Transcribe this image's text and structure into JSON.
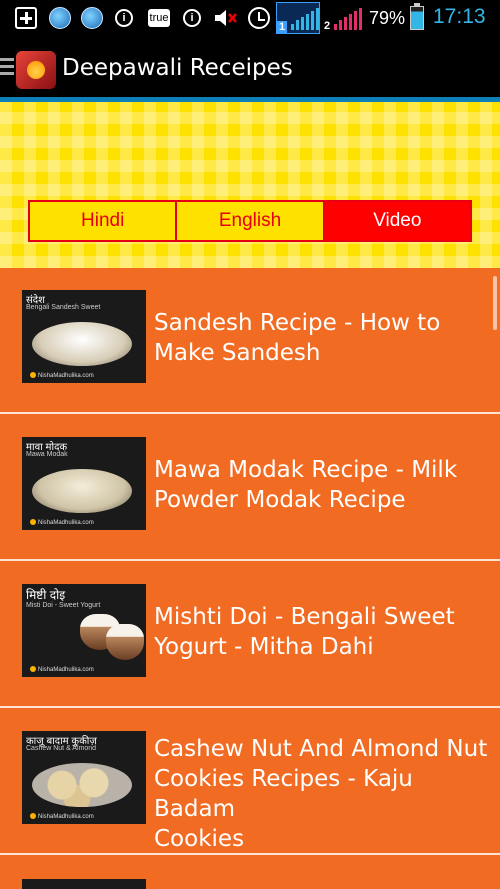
{
  "status_bar": {
    "icons": [
      "plus-box-icon",
      "globe-icon",
      "globe-icon",
      "info-icon",
      "true-icon",
      "info-icon",
      "volume-muted-icon",
      "alarm-icon",
      "signal-sim1-icon",
      "signal-sim2-icon",
      "battery-icon"
    ],
    "true_label": "true",
    "sim1": "1",
    "sim2": "2",
    "battery_text": "79%",
    "battery_level": 0.79,
    "time": "17:13"
  },
  "action_bar": {
    "title": "Deepawali Receipes",
    "background": "#000000",
    "accent": "#0f7fb8"
  },
  "tabs": [
    {
      "label": "Hindi",
      "active": false
    },
    {
      "label": "English",
      "active": false
    },
    {
      "label": "Video",
      "active": true
    }
  ],
  "colors": {
    "banner": "#ffe100",
    "tab_border": "#e60012",
    "tab_active": "#ff0000",
    "list_background": "#f26b22",
    "text": "#ffffff"
  },
  "items": [
    {
      "title_lines": [
        "Sandesh Recipe - How to",
        "Make Sandesh"
      ],
      "thumb": {
        "label_hi": "संदेश",
        "label_en": "Bengali Sandesh Sweet",
        "watermark": "NishaMadhulika.com"
      }
    },
    {
      "title_lines": [
        "Mawa Modak Recipe - Milk",
        "Powder Modak Recipe"
      ],
      "thumb": {
        "label_hi": "मावा मोदक",
        "label_en": "Mawa Modak",
        "watermark": "NishaMadhulika.com"
      }
    },
    {
      "title_lines": [
        "Mishti Doi - Bengali Sweet",
        "Yogurt - Mitha Dahi"
      ],
      "thumb": {
        "label_hi": "मिष्टी दोइ",
        "label_en": "Misti Doi - Sweet Yogurt",
        "watermark": "NishaMadhulika.com"
      }
    },
    {
      "title_lines": [
        "Cashew Nut And Almond Nut",
        "Cookies Recipes - Kaju Badam",
        "Cookies"
      ],
      "thumb": {
        "label_hi": "काजू बादाम कुकीज़",
        "label_en": "Cashew Nut & Almond",
        "watermark": "NishaMadhulika.com"
      }
    }
  ]
}
